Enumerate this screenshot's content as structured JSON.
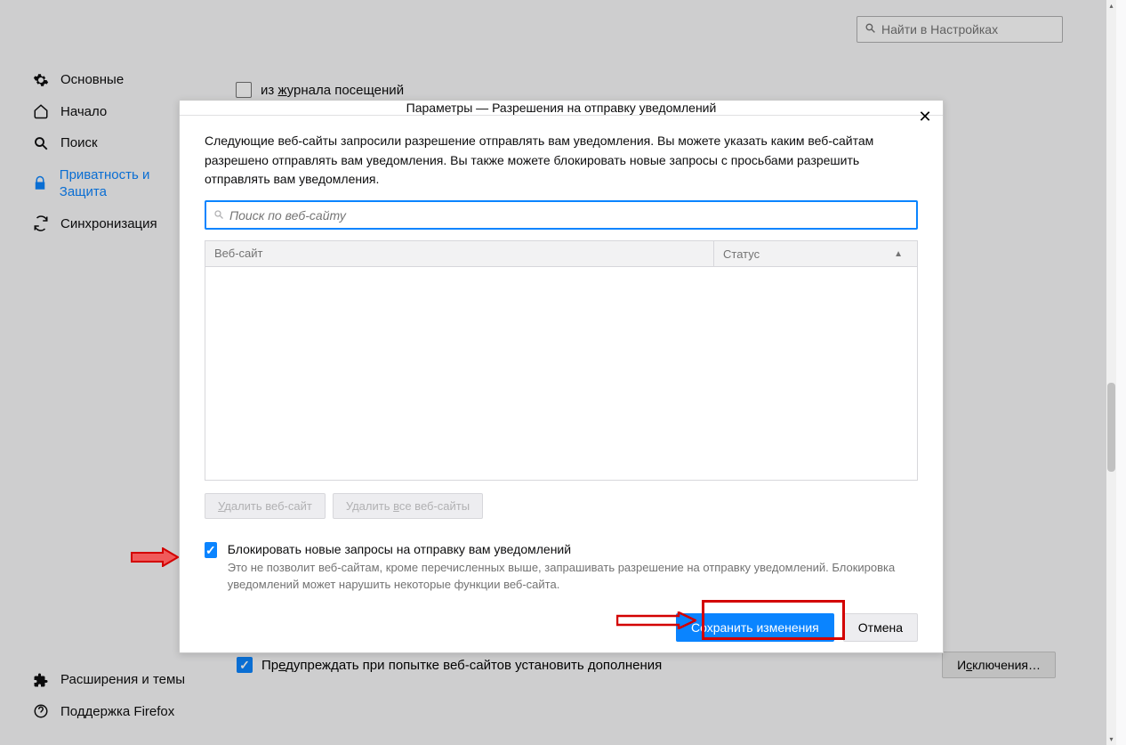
{
  "sidebar": {
    "items": [
      {
        "label": "Основные"
      },
      {
        "label": "Начало"
      },
      {
        "label": "Поиск"
      },
      {
        "label": "Приватность и Защита"
      },
      {
        "label": "Синхронизация"
      }
    ],
    "footer": [
      {
        "label": "Расширения и темы"
      },
      {
        "label": "Поддержка Firefox"
      }
    ]
  },
  "header_search": {
    "placeholder": "Найти в Настройках"
  },
  "bg_row1": {
    "label": "из журнала посещений"
  },
  "bg_row2": {
    "label": "Предупреждать при попытке веб-сайтов установить дополнения"
  },
  "bg_button": {
    "label": "Исключения…"
  },
  "dialog": {
    "title": "Параметры — Разрешения на отправку уведомлений",
    "description": "Следующие веб-сайты запросили разрешение отправлять вам уведомления. Вы можете указать каким веб-сайтам разрешено отправлять вам уведомления. Вы также можете блокировать новые запросы с просьбами разрешить отправлять вам уведомления.",
    "search_placeholder": "Поиск по веб-сайту",
    "columns": {
      "website": "Веб-сайт",
      "status": "Статус"
    },
    "remove_site": "Удалить веб-сайт",
    "remove_all": "Удалить все веб-сайты",
    "block_label": "Блокировать новые запросы на отправку вам уведомлений",
    "block_desc": "Это не позволит веб-сайтам, кроме перечисленных выше, запрашивать разрешение на отправку уведомлений. Блокировка уведомлений может нарушить некоторые функции веб-сайта.",
    "save": "Сохранить изменения",
    "cancel": "Отмена"
  }
}
